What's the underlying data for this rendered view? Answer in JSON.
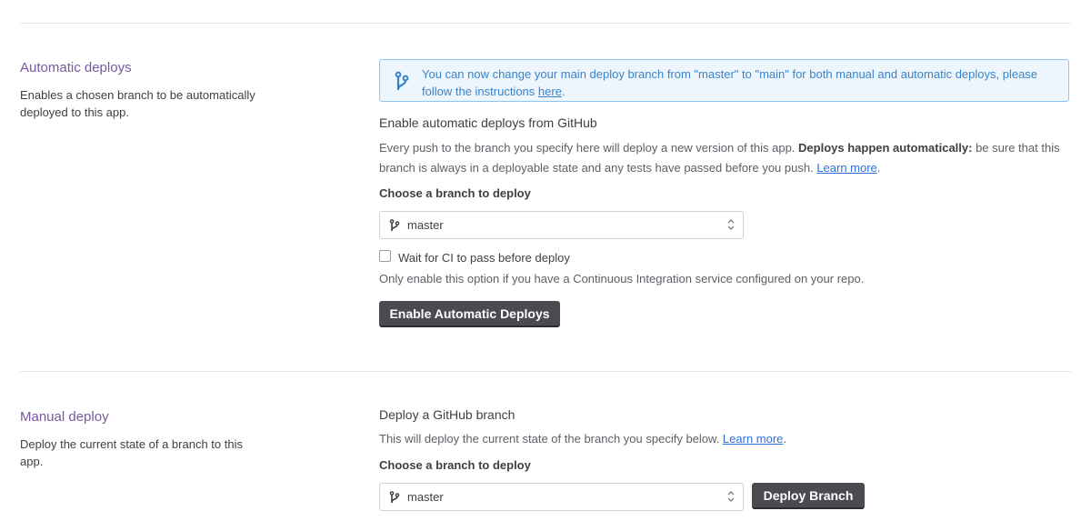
{
  "automatic": {
    "title": "Automatic deploys",
    "description": "Enables a chosen branch to be automatically deployed to this app.",
    "notice": {
      "text_before": "You can now change your main deploy branch from \"master\" to \"main\" for both manual and automatic deploys, please follow the instructions ",
      "link": "here",
      "text_after": "."
    },
    "subheading": "Enable automatic deploys from GitHub",
    "para_before": "Every push to the branch you specify here will deploy a new version of this app. ",
    "para_bold": "Deploys happen automatically:",
    "para_after": " be sure that this branch is always in a deployable state and any tests have passed before you push. ",
    "learn_more": "Learn more",
    "period": ".",
    "branch_label": "Choose a branch to deploy",
    "branch_value": "master",
    "ci_label": "Wait for CI to pass before deploy",
    "ci_help": "Only enable this option if you have a Continuous Integration service configured on your repo.",
    "button": "Enable Automatic Deploys"
  },
  "manual": {
    "title": "Manual deploy",
    "description": "Deploy the current state of a branch to this app.",
    "subheading": "Deploy a GitHub branch",
    "para": "This will deploy the current state of the branch you specify below. ",
    "learn_more": "Learn more",
    "period": ".",
    "branch_label": "Choose a branch to deploy",
    "branch_value": "master",
    "button": "Deploy Branch"
  },
  "icons": {
    "notice": "branch-icon",
    "select": "branch-icon",
    "select_arrow": "chevron-updown-icon"
  },
  "colors": {
    "section_title": "#79589f",
    "notice_bg": "#eef6fd",
    "notice_border": "#8ec4f2",
    "notice_text": "#3b83c9",
    "link": "#2f6fdb",
    "button_bg": "#4a4a50"
  }
}
